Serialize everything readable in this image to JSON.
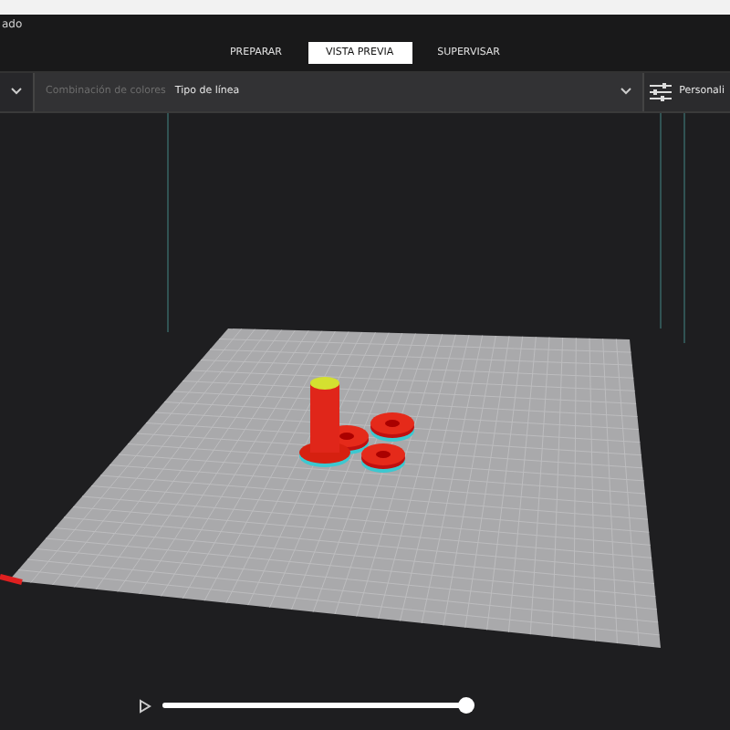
{
  "window": {
    "title": "ado"
  },
  "tabs": [
    {
      "label": "PREPARAR",
      "selected": false
    },
    {
      "label": "VISTA PREVIA",
      "selected": true
    },
    {
      "label": "SUPERVISAR",
      "selected": false
    }
  ],
  "toolbar": {
    "color_scheme_label": "Combinación de colores",
    "color_scheme_value": "Tipo de línea",
    "settings_button": "Personali"
  },
  "layer_slider": {
    "level": 1
  }
}
